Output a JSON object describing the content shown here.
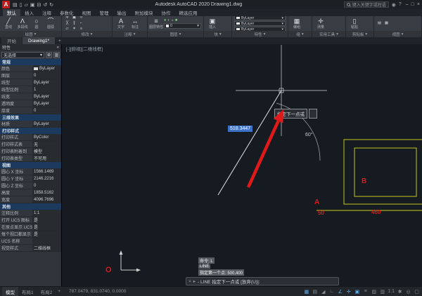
{
  "ui": {
    "caret_down": "▾",
    "plus": "+",
    "close": "×",
    "prompt_arrow": "▸",
    "collapse": "«"
  },
  "titlebar": {
    "title": "Autodesk AutoCAD 2020  Drawing1.dwg",
    "search_placeholder": "键入关键字或短语",
    "quick_access": [
      {
        "name": "workspace",
        "glyph": "▤"
      },
      {
        "name": "new-file",
        "glyph": "▯"
      },
      {
        "name": "open-file",
        "glyph": "▱"
      },
      {
        "name": "save",
        "glyph": "▣"
      },
      {
        "name": "print",
        "glyph": "⊟"
      },
      {
        "name": "undo",
        "glyph": "↺"
      },
      {
        "name": "redo",
        "glyph": "↻"
      }
    ],
    "window": [
      "–",
      "□",
      "×"
    ]
  },
  "ribbon": {
    "tabs": [
      {
        "label": "默认",
        "active": true
      },
      {
        "label": "插入"
      },
      {
        "label": "注释"
      },
      {
        "label": "参数化"
      },
      {
        "label": "视图"
      },
      {
        "label": "管理"
      },
      {
        "label": "输出"
      },
      {
        "label": "附加模块"
      },
      {
        "label": "协作"
      },
      {
        "label": "精选应用"
      }
    ],
    "panels": [
      {
        "name": "draw",
        "label": "绘图",
        "big": [
          {
            "name": "line",
            "glyph": "╱",
            "label": "直线"
          },
          {
            "name": "polyline",
            "glyph": "Λ",
            "label": "多段线"
          },
          {
            "name": "circle",
            "glyph": "○",
            "label": "圆"
          },
          {
            "name": "arc",
            "glyph": "⌒",
            "label": "圆弧"
          }
        ]
      },
      {
        "name": "modify",
        "label": "修改",
        "small": [
          {
            "name": "move",
            "glyph": "✛"
          },
          {
            "name": "copy",
            "glyph": "▣"
          },
          {
            "name": "rotate",
            "glyph": "↺"
          },
          {
            "name": "trim",
            "glyph": "╳"
          },
          {
            "name": "mirror",
            "glyph": "∥"
          },
          {
            "name": "fillet",
            "glyph": "⌐"
          },
          {
            "name": "erase",
            "glyph": "▱"
          },
          {
            "name": "explode",
            "glyph": "✶"
          },
          {
            "name": "offset",
            "glyph": "≡"
          }
        ]
      },
      {
        "name": "annotation",
        "label": "注释",
        "big": [
          {
            "name": "text",
            "glyph": "A",
            "label": "文字"
          },
          {
            "name": "dimension",
            "glyph": "↔",
            "label": "标注"
          }
        ]
      },
      {
        "name": "layers",
        "label": "图层",
        "big": [
          {
            "name": "layer-properties",
            "glyph": "≡",
            "label": "图层特性"
          }
        ],
        "layerbar": [
          {
            "name": "layer-on",
            "glyph": "●"
          },
          {
            "name": "layer-freeze",
            "glyph": "◐"
          },
          {
            "name": "layer-lock",
            "glyph": "◒"
          },
          {
            "name": "layer-color",
            "glyph": "■"
          }
        ],
        "dropdown": "0"
      },
      {
        "name": "block",
        "label": "块",
        "big": [
          {
            "name": "insert-block",
            "glyph": "▣",
            "label": "插入"
          }
        ]
      },
      {
        "name": "properties",
        "label": "特性",
        "bylayers": [
          {
            "value": "ByLayer"
          },
          {
            "value": "ByLayer"
          },
          {
            "value": "ByLayer"
          }
        ]
      },
      {
        "name": "groups",
        "label": "组",
        "big": [
          {
            "name": "group",
            "glyph": "▦",
            "label": "编组"
          }
        ]
      },
      {
        "name": "utilities",
        "label": "实用工具",
        "big": [
          {
            "name": "measure",
            "glyph": "✛",
            "label": "测量"
          }
        ]
      },
      {
        "name": "clipboard",
        "label": "剪贴板",
        "big": [
          {
            "name": "paste",
            "glyph": "▯",
            "label": "粘贴"
          }
        ]
      },
      {
        "name": "view",
        "label": "视图",
        "small": [
          {
            "name": "named-views",
            "glyph": "▤"
          },
          {
            "name": "viewports",
            "glyph": "▦"
          }
        ]
      }
    ]
  },
  "filetabs": {
    "tabs": [
      {
        "label": "开始"
      },
      {
        "label": "Drawing1*",
        "active": true
      }
    ]
  },
  "properties": {
    "title": "特性",
    "selection": "无选择",
    "sections": [
      {
        "header": "常规",
        "rows": [
          [
            "颜色",
            "ByLayer"
          ],
          [
            "图层",
            "0"
          ],
          [
            "线型",
            "ByLayer"
          ],
          [
            "线型比例",
            "1"
          ],
          [
            "线宽",
            "ByLayer"
          ],
          [
            "透明度",
            "ByLayer"
          ],
          [
            "厚度",
            "0"
          ]
        ]
      },
      {
        "header": "三维效果",
        "rows": [
          [
            "材质",
            "ByLayer"
          ]
        ]
      },
      {
        "header": "打印样式",
        "rows": [
          [
            "打印样式",
            "ByColor"
          ],
          [
            "打印样式表",
            "无"
          ],
          [
            "打印表附着到",
            "模型"
          ],
          [
            "打印表类型",
            "不可用"
          ]
        ]
      },
      {
        "header": "视图",
        "rows": [
          [
            "圆心 X 坐标",
            "1566.1469"
          ],
          [
            "圆心 Y 坐标",
            "2146.2216"
          ],
          [
            "圆心 Z 坐标",
            "0"
          ],
          [
            "高度",
            "1858.5162"
          ],
          [
            "宽度",
            "4096.7696"
          ]
        ]
      },
      {
        "header": "其他",
        "rows": [
          [
            "注释比例",
            "1:1"
          ],
          [
            "打开 UCS 图标",
            "是"
          ],
          [
            "在原点显示 UCS 图标",
            "是"
          ],
          [
            "每个视口都显示 UCS 图标",
            "是"
          ],
          [
            "UCS 名称",
            ""
          ],
          [
            "视觉样式",
            "二维线框"
          ]
        ]
      }
    ]
  },
  "canvas": {
    "viewport_label": "[-][俯视][二维线框]",
    "tooltip": "指定下一点或",
    "dim_input": "518.3447",
    "angle_label": "60°",
    "labels": {
      "a": "A",
      "b": "B",
      "d50": "50",
      "d460": "460",
      "o": "O"
    },
    "cmd_history": [
      "命令: L",
      "LINE",
      "指定第一个点: 500,400"
    ],
    "command_line": "- LINE  指定下一点或 [放弃(U)]:",
    "colors": {
      "annotation_red": "#e01a1a",
      "drawing_yellow": "#a8a820",
      "dyn_input_blue": "#3d72c8"
    }
  },
  "statusbar": {
    "model_tabs": [
      {
        "label": "模型",
        "active": true
      },
      {
        "label": "布局1"
      },
      {
        "label": "布局2"
      }
    ],
    "coords": "787.0479, 831.0740, 0.0000",
    "icons": [
      {
        "name": "grid",
        "glyph": "▦",
        "on": true
      },
      {
        "name": "snap-mode",
        "glyph": "▤",
        "on": false
      },
      {
        "name": "infer-constraints",
        "glyph": "◢",
        "on": false
      },
      {
        "name": "ortho-mode",
        "glyph": "∟",
        "on": false
      },
      {
        "name": "polar-tracking",
        "glyph": "∠",
        "on": true
      },
      {
        "name": "osnap-tracking",
        "glyph": "✛",
        "on": true
      },
      {
        "name": "object-snap",
        "glyph": "▣",
        "on": true
      },
      {
        "name": "lineweight",
        "glyph": "≡",
        "on": false
      },
      {
        "name": "transparency",
        "glyph": "▨",
        "on": false
      },
      {
        "name": "selection-cycling",
        "glyph": "▥",
        "on": false
      },
      {
        "name": "annotation-scale",
        "glyph": "1:1",
        "on": false
      },
      {
        "name": "annotation-visibility",
        "glyph": "✱",
        "on": false
      },
      {
        "name": "workspace-switching",
        "glyph": "◎",
        "on": false
      },
      {
        "name": "clean-screen",
        "glyph": "▢",
        "on": false
      }
    ]
  }
}
